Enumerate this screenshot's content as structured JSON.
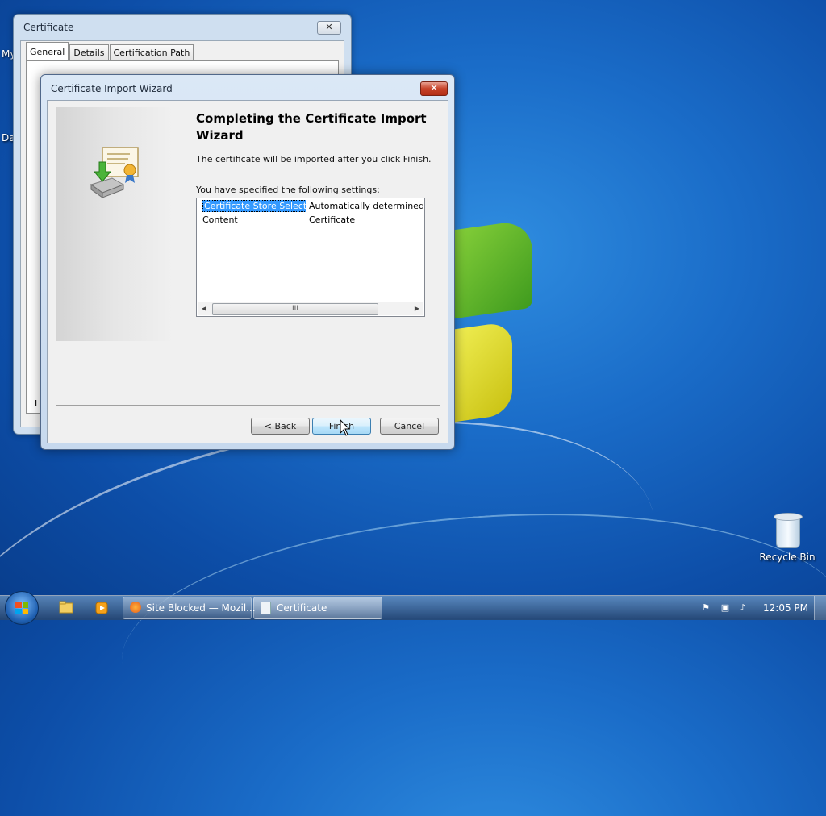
{
  "desktop": {
    "partial_labels": [
      "My",
      "Da"
    ],
    "recycle_bin_label": "Recycle Bin"
  },
  "certificate_window": {
    "title": "Certificate",
    "close_glyph": "✕",
    "tabs": [
      "General",
      "Details",
      "Certification Path"
    ],
    "partial_text": "Le"
  },
  "wizard": {
    "title": "Certificate Import Wizard",
    "close_glyph": "✕",
    "heading": "Completing the Certificate Import Wizard",
    "info": "The certificate will be imported after you click Finish.",
    "settings_label": "You have specified the following settings:",
    "settings": [
      {
        "name": "Certificate Store Selected",
        "value": "Automatically determined by t"
      },
      {
        "name": "Content",
        "value": "Certificate"
      }
    ],
    "scroll_thumb_grip": "III",
    "buttons": {
      "back": "< Back",
      "finish": "Finish",
      "cancel": "Cancel"
    }
  },
  "taskbar": {
    "items": [
      {
        "label": "Site Blocked — Mozil..."
      },
      {
        "label": "Certificate"
      }
    ],
    "clock": "12:05 PM"
  },
  "colors": {
    "selection": "#3399ff",
    "close_button": "#c7432a",
    "desktop": "#1a6cc8"
  }
}
